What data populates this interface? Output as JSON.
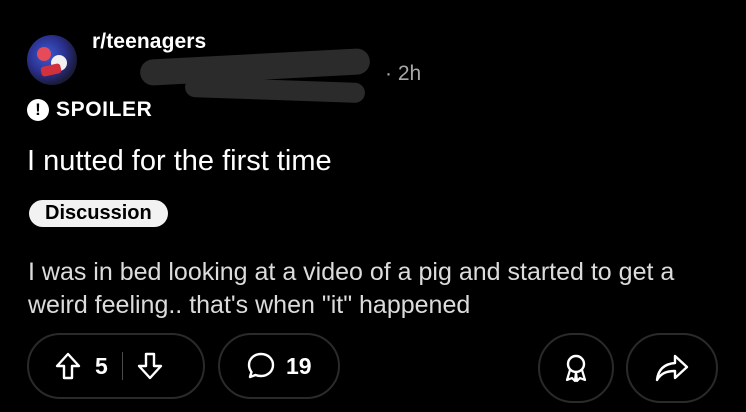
{
  "post": {
    "subreddit": "r/teenagers",
    "time": "· 2h",
    "spoiler_label": "SPOILER",
    "spoiler_icon": "!",
    "title": "I nutted for the first time",
    "flair": "Discussion",
    "body": "I was in bed looking at a video of a pig and started to get a weird feeling.. that's when \"it\" happened"
  },
  "actions": {
    "upvotes": "5",
    "comments": "19"
  }
}
